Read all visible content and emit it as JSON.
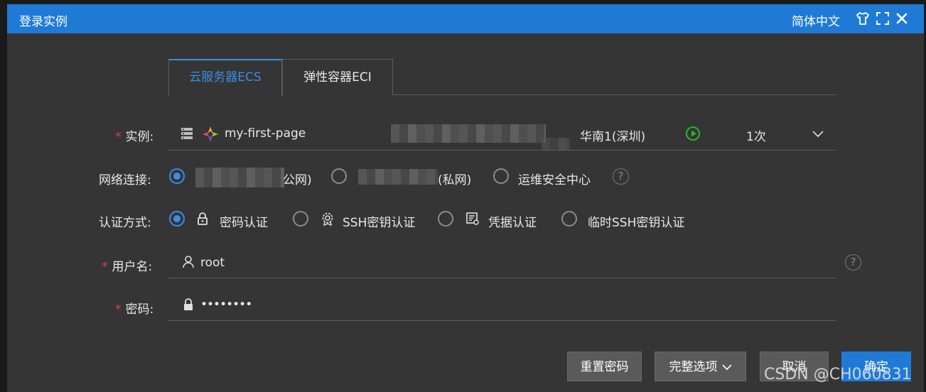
{
  "window": {
    "title": "登录实例",
    "language": "简体中文"
  },
  "tabs": [
    {
      "label": "云服务器ECS",
      "active": true
    },
    {
      "label": "弹性容器ECI",
      "active": false
    }
  ],
  "instance": {
    "label": "实例:",
    "name": "my-first-page",
    "region": "华南1(深圳)",
    "count": "1次"
  },
  "network": {
    "label": "网络连接:",
    "options": [
      {
        "suffix": "公网)",
        "selected": true
      },
      {
        "suffix": "(私网)",
        "selected": false
      },
      {
        "suffix": "运维安全中心",
        "selected": false
      }
    ]
  },
  "auth": {
    "label": "认证方式:",
    "options": [
      {
        "label": "密码认证",
        "selected": true,
        "icon": "lock-icon"
      },
      {
        "label": "SSH密钥认证",
        "selected": false,
        "icon": "badge-icon"
      },
      {
        "label": "凭据认证",
        "selected": false,
        "icon": "certificate-icon"
      },
      {
        "label": "临时SSH密钥认证",
        "selected": false
      }
    ]
  },
  "username": {
    "label": "用户名:",
    "value": "root"
  },
  "password": {
    "label": "密码:",
    "value": "••••••••"
  },
  "buttons": {
    "reset": "重置密码",
    "options": "完整选项",
    "cancel": "取消",
    "confirm": "确定"
  },
  "watermark": "CSDN @CH060831",
  "colors": {
    "titlebar": "#1f7ad6",
    "accent": "#3a8ee6",
    "required": "#e04040",
    "background": "#353535"
  }
}
